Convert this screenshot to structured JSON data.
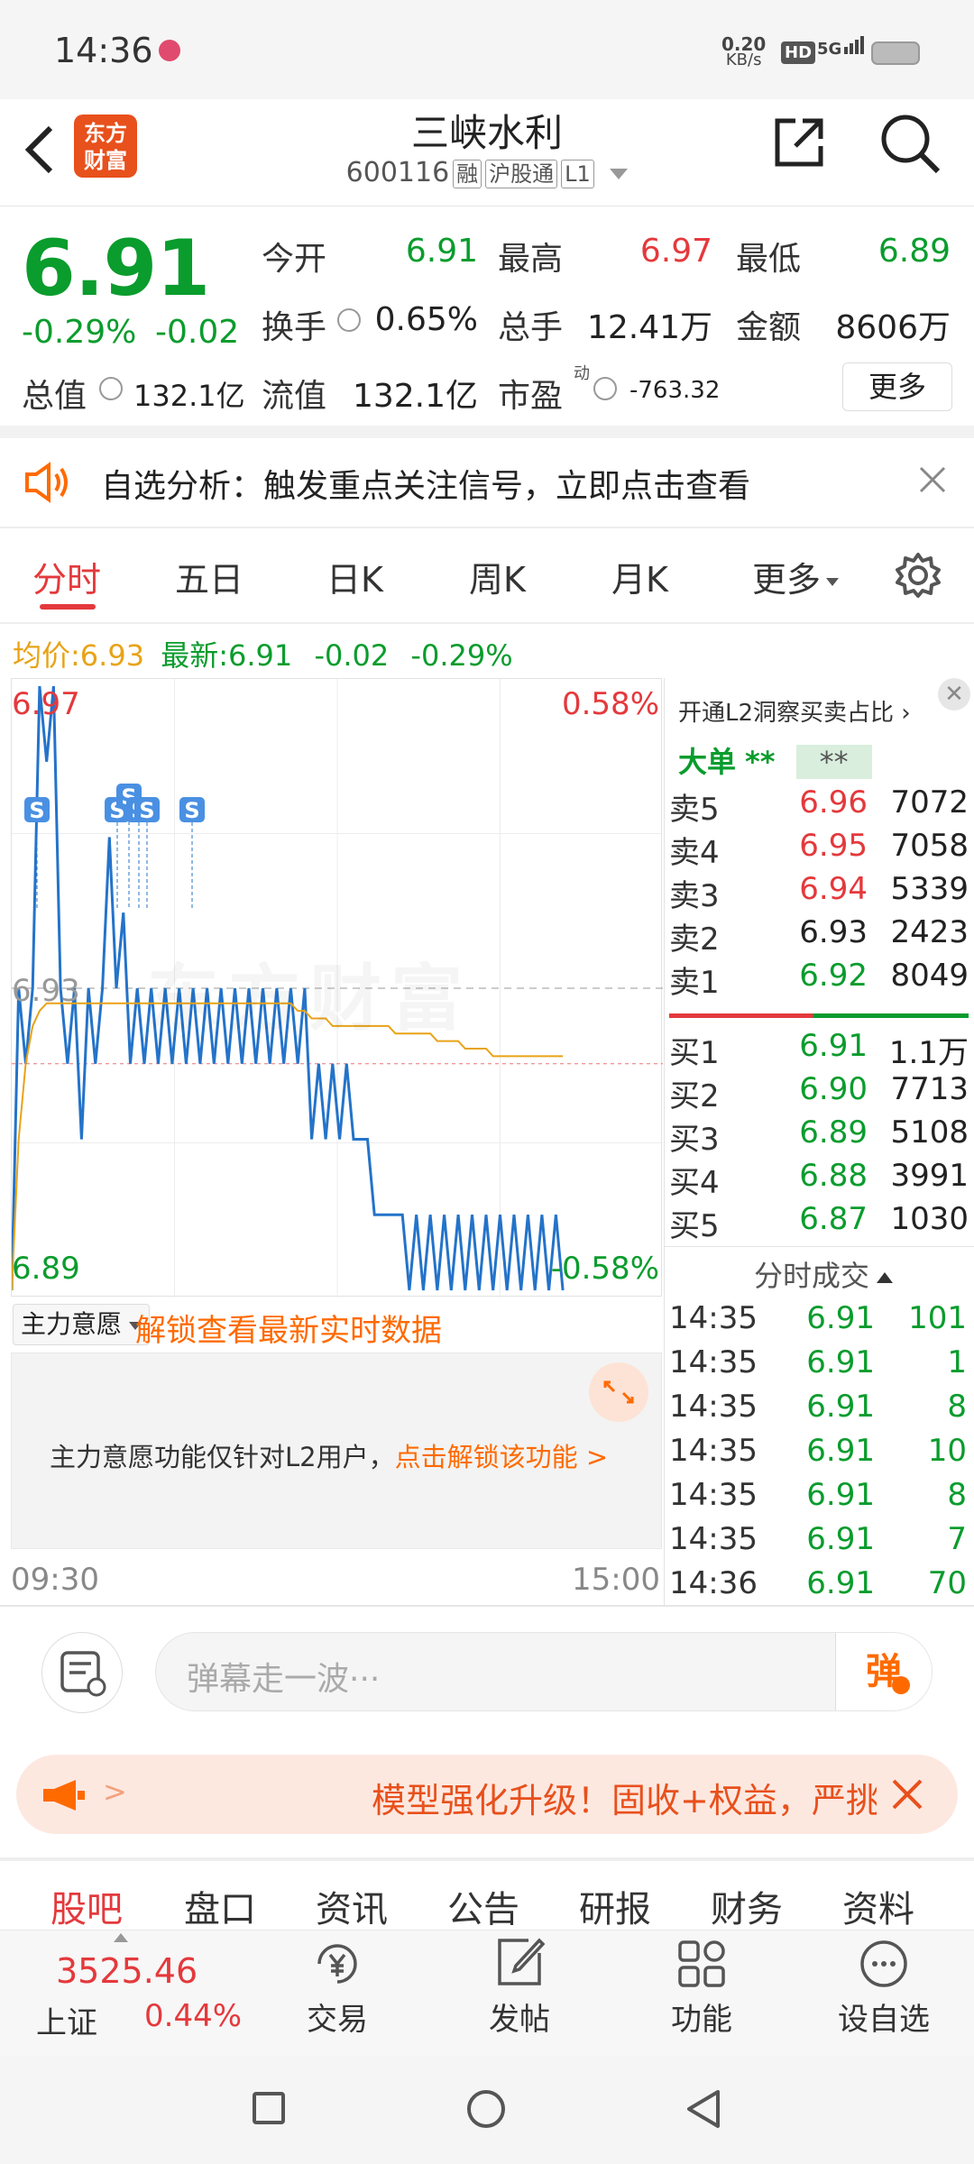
{
  "status": {
    "time": "14:36",
    "net_speed": "0.20",
    "net_unit": "KB/s",
    "hd": "HD",
    "signal": "5G"
  },
  "header": {
    "logo_line1": "东方",
    "logo_line2": "财富",
    "title": "三峡水利",
    "code": "600116",
    "tags": [
      "融",
      "沪股通",
      "L1"
    ]
  },
  "quote": {
    "price": "6.91",
    "change_pct": "-0.29%",
    "change": "-0.02",
    "open_label": "今开",
    "open": "6.91",
    "high_label": "最高",
    "high": "6.97",
    "low_label": "最低",
    "low": "6.89",
    "turnover_label": "换手",
    "turnover": "0.65%",
    "volume_label": "总手",
    "volume": "12.41万",
    "amount_label": "金额",
    "amount": "8606万",
    "mktcap_label": "总值",
    "mktcap": "132.1亿",
    "float_label": "流值",
    "float_cap": "132.1亿",
    "pe_label": "市盈",
    "pe_sup": "动",
    "pe": "-763.32",
    "more": "更多"
  },
  "banner": {
    "text": "自选分析：触发重点关注信号，立即点击查看"
  },
  "tabs": [
    "分时",
    "五日",
    "日K",
    "周K",
    "月K",
    "更多"
  ],
  "chart_legend": {
    "avg_label": "均价:",
    "avg": "6.93",
    "latest_label": "最新:",
    "latest": "6.91",
    "chg": "-0.02",
    "chg_pct": "-0.29%"
  },
  "chart_data": {
    "type": "line",
    "y_range": [
      6.89,
      6.97
    ],
    "y_top": "6.97",
    "y_mid": "6.93",
    "y_bottom": "6.89",
    "pct_top": "0.58%",
    "pct_bottom": "-0.58%",
    "x_start": "09:30",
    "x_end": "15:00",
    "watermark": "东方财富",
    "series": [
      {
        "values": [
          6.89,
          6.93,
          6.92,
          6.93,
          6.97,
          6.96,
          6.97,
          6.93,
          6.92,
          6.93,
          6.91,
          6.93,
          6.92,
          6.93,
          6.95,
          6.93,
          6.94,
          6.92,
          6.93,
          6.92,
          6.93,
          6.92,
          6.93,
          6.92,
          6.93,
          6.92,
          6.93,
          6.92,
          6.93,
          6.92,
          6.93,
          6.92,
          6.93,
          6.92,
          6.93,
          6.92,
          6.93,
          6.92,
          6.93,
          6.92,
          6.93,
          6.92,
          6.93,
          6.91,
          6.92,
          6.91,
          6.92,
          6.91,
          6.92,
          6.91,
          6.91,
          6.91,
          6.9,
          6.9,
          6.9,
          6.9,
          6.9,
          6.89,
          6.9,
          6.89,
          6.9,
          6.89,
          6.9,
          6.89,
          6.9,
          6.89,
          6.9,
          6.89,
          6.9,
          6.89,
          6.9,
          6.89,
          6.9,
          6.89,
          6.9,
          6.89,
          6.9,
          6.89,
          6.9,
          6.89
        ]
      },
      {
        "values": [
          6.89,
          6.91,
          6.92,
          6.925,
          6.927,
          6.928,
          6.928,
          6.928,
          6.928,
          6.928,
          6.928,
          6.928,
          6.928,
          6.928,
          6.928,
          6.928,
          6.928,
          6.928,
          6.928,
          6.928,
          6.928,
          6.928,
          6.928,
          6.928,
          6.928,
          6.928,
          6.928,
          6.928,
          6.928,
          6.928,
          6.928,
          6.928,
          6.928,
          6.928,
          6.928,
          6.928,
          6.928,
          6.928,
          6.928,
          6.928,
          6.928,
          6.927,
          6.927,
          6.926,
          6.926,
          6.926,
          6.925,
          6.925,
          6.925,
          6.925,
          6.925,
          6.925,
          6.925,
          6.925,
          6.925,
          6.924,
          6.924,
          6.924,
          6.924,
          6.924,
          6.924,
          6.923,
          6.923,
          6.923,
          6.923,
          6.922,
          6.922,
          6.922,
          6.922,
          6.921,
          6.921,
          6.921,
          6.921,
          6.921,
          6.921,
          6.921,
          6.921,
          6.921,
          6.921,
          6.921
        ]
      }
    ],
    "s_markers": [
      "S",
      "S",
      "S",
      "S",
      "S",
      "S"
    ]
  },
  "orderbook": {
    "promo": "开通L2洞察买卖占比",
    "big_label": "大单",
    "big_val1": "**",
    "big_val2": "**",
    "asks": [
      {
        "label": "卖5",
        "price": "6.96",
        "vol": "7072"
      },
      {
        "label": "卖4",
        "price": "6.95",
        "vol": "7058"
      },
      {
        "label": "卖3",
        "price": "6.94",
        "vol": "5339"
      },
      {
        "label": "卖2",
        "price": "6.93",
        "vol": "2423"
      },
      {
        "label": "卖1",
        "price": "6.92",
        "vol": "8049"
      }
    ],
    "bids": [
      {
        "label": "买1",
        "price": "6.91",
        "vol": "1.1万"
      },
      {
        "label": "买2",
        "price": "6.90",
        "vol": "7713"
      },
      {
        "label": "买3",
        "price": "6.89",
        "vol": "5108"
      },
      {
        "label": "买4",
        "price": "6.88",
        "vol": "3991"
      },
      {
        "label": "买5",
        "price": "6.87",
        "vol": "1030"
      }
    ],
    "trades_title": "分时成交",
    "trades": [
      {
        "time": "14:35",
        "price": "6.91",
        "vol": "101"
      },
      {
        "time": "14:35",
        "price": "6.91",
        "vol": "1"
      },
      {
        "time": "14:35",
        "price": "6.91",
        "vol": "8"
      },
      {
        "time": "14:35",
        "price": "6.91",
        "vol": "10"
      },
      {
        "time": "14:35",
        "price": "6.91",
        "vol": "8"
      },
      {
        "time": "14:35",
        "price": "6.91",
        "vol": "7"
      },
      {
        "time": "14:36",
        "price": "6.91",
        "vol": "70"
      }
    ]
  },
  "main_force": {
    "dropdown": "主力意愿",
    "unlock": "解锁查看最新实时数据",
    "msg": "主力意愿功能仅针对L2用户，",
    "link": "点击解锁该功能 >"
  },
  "danmaku": {
    "placeholder": "弹幕走一波···",
    "btn": "弹"
  },
  "promo_banner": {
    "arrow": ">",
    "text": "模型强化升级！固收+权益，严挑"
  },
  "bottom_tabs": [
    "股吧",
    "盘口",
    "资讯",
    "公告",
    "研报",
    "财务",
    "资料"
  ],
  "index": {
    "value": "3525.46",
    "name": "上证",
    "pct": "0.44%"
  },
  "bottom_nav": [
    {
      "label": "交易"
    },
    {
      "label": "发帖"
    },
    {
      "label": "功能"
    },
    {
      "label": "设自选"
    }
  ]
}
